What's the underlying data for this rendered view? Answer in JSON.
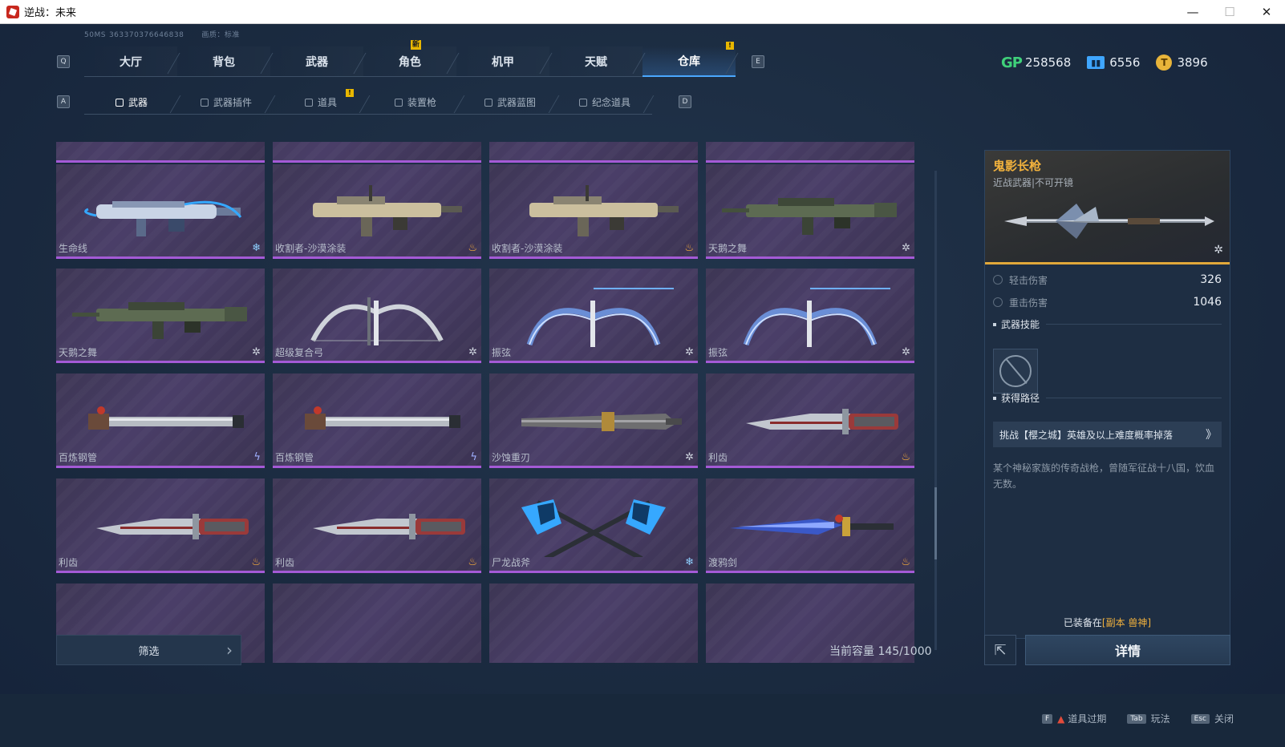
{
  "window": {
    "title": "逆战：未来",
    "minimize": "—",
    "maximize": "☐",
    "close": "✕"
  },
  "info": {
    "ping": "50MS",
    "uid": "363370376646838",
    "quality": "画质：标准"
  },
  "keys": {
    "prev_main": "Q",
    "next_main": "E",
    "prev_sub": "A",
    "next_sub": "D"
  },
  "main_tabs": [
    {
      "label": "大厅"
    },
    {
      "label": "背包"
    },
    {
      "label": "武器"
    },
    {
      "label": "角色",
      "badge": "新"
    },
    {
      "label": "机甲"
    },
    {
      "label": "天赋"
    },
    {
      "label": "仓库",
      "badge": "!"
    }
  ],
  "currencies": [
    {
      "icon": "gp-icon",
      "glyph": "GP",
      "value": "258568"
    },
    {
      "icon": "ticket-icon",
      "glyph": "▮▮",
      "value": "6556"
    },
    {
      "icon": "coin-icon",
      "glyph": "T",
      "value": "3896"
    }
  ],
  "sub_tabs": [
    {
      "label": "武器"
    },
    {
      "label": "武器插件"
    },
    {
      "label": "道具",
      "badge": "!"
    },
    {
      "label": "装置枪"
    },
    {
      "label": "武器蓝图"
    },
    {
      "label": "纪念道具"
    }
  ],
  "cards": [
    {
      "name": "生命线",
      "rarity": "ice",
      "glyph": "❄",
      "kind": "rifle-blue"
    },
    {
      "name": "收割者-沙漠涂装",
      "rarity": "fire",
      "glyph": "♨",
      "kind": "rifle-tan"
    },
    {
      "name": "收割者-沙漠涂装",
      "rarity": "fire",
      "glyph": "♨",
      "kind": "rifle-tan"
    },
    {
      "name": "天鹅之舞",
      "rarity": "cross",
      "glyph": "✲",
      "kind": "rifle-green"
    },
    {
      "name": "天鹅之舞",
      "rarity": "cross",
      "glyph": "✲",
      "kind": "rifle-green"
    },
    {
      "name": "超级复合弓",
      "rarity": "cross",
      "glyph": "✲",
      "kind": "bow-grey"
    },
    {
      "name": "振弦",
      "rarity": "cross",
      "glyph": "✲",
      "kind": "bow-blue"
    },
    {
      "name": "振弦",
      "rarity": "cross",
      "glyph": "✲",
      "kind": "bow-blue"
    },
    {
      "name": "百炼钢管",
      "rarity": "bolt",
      "glyph": "ϟ",
      "kind": "pipe"
    },
    {
      "name": "百炼钢管",
      "rarity": "bolt",
      "glyph": "ϟ",
      "kind": "pipe"
    },
    {
      "name": "沙蚀重刃",
      "rarity": "cross",
      "glyph": "✲",
      "kind": "greatblade"
    },
    {
      "name": "利齿",
      "rarity": "fire",
      "glyph": "♨",
      "kind": "knife"
    },
    {
      "name": "利齿",
      "rarity": "fire",
      "glyph": "♨",
      "kind": "knife"
    },
    {
      "name": "利齿",
      "rarity": "fire",
      "glyph": "♨",
      "kind": "knife"
    },
    {
      "name": "尸龙战斧",
      "rarity": "ice",
      "glyph": "❄",
      "kind": "axes"
    },
    {
      "name": "渡鸦剑",
      "rarity": "fire",
      "glyph": "♨",
      "kind": "sword-blue"
    }
  ],
  "detail": {
    "title": "鬼影长枪",
    "subtitle": "近战武器|不可开镜",
    "rarity_glyph": "✲",
    "stats": [
      {
        "label": "轻击伤害",
        "value": "326"
      },
      {
        "label": "重击伤害",
        "value": "1046"
      }
    ],
    "skill_header": "武器技能",
    "path_header": "获得路径",
    "path_text": "挑战【樱之城】英雄及以上难度概率掉落",
    "path_arrow": "》",
    "description": "某个神秘家族的传奇战枪，曾随军征战十八国，饮血无数。",
    "equipped_prefix": "已装备在",
    "equipped_target": "[副本 兽神]"
  },
  "filter": {
    "label": "筛选",
    "chevron": "›"
  },
  "capacity": "当前容量 145/1000",
  "share_icon": "⇱",
  "details_button": "详情",
  "hotkeys": [
    {
      "key": "F",
      "warn": "▲",
      "label": "道具过期"
    },
    {
      "key": "Tab",
      "warn": "",
      "label": "玩法"
    },
    {
      "key": "Esc",
      "warn": "",
      "label": "关闭"
    }
  ],
  "colors": {
    "accent": "#4aa8ff",
    "epic_purple": "#a45ad6",
    "gold": "#f2b23d"
  }
}
